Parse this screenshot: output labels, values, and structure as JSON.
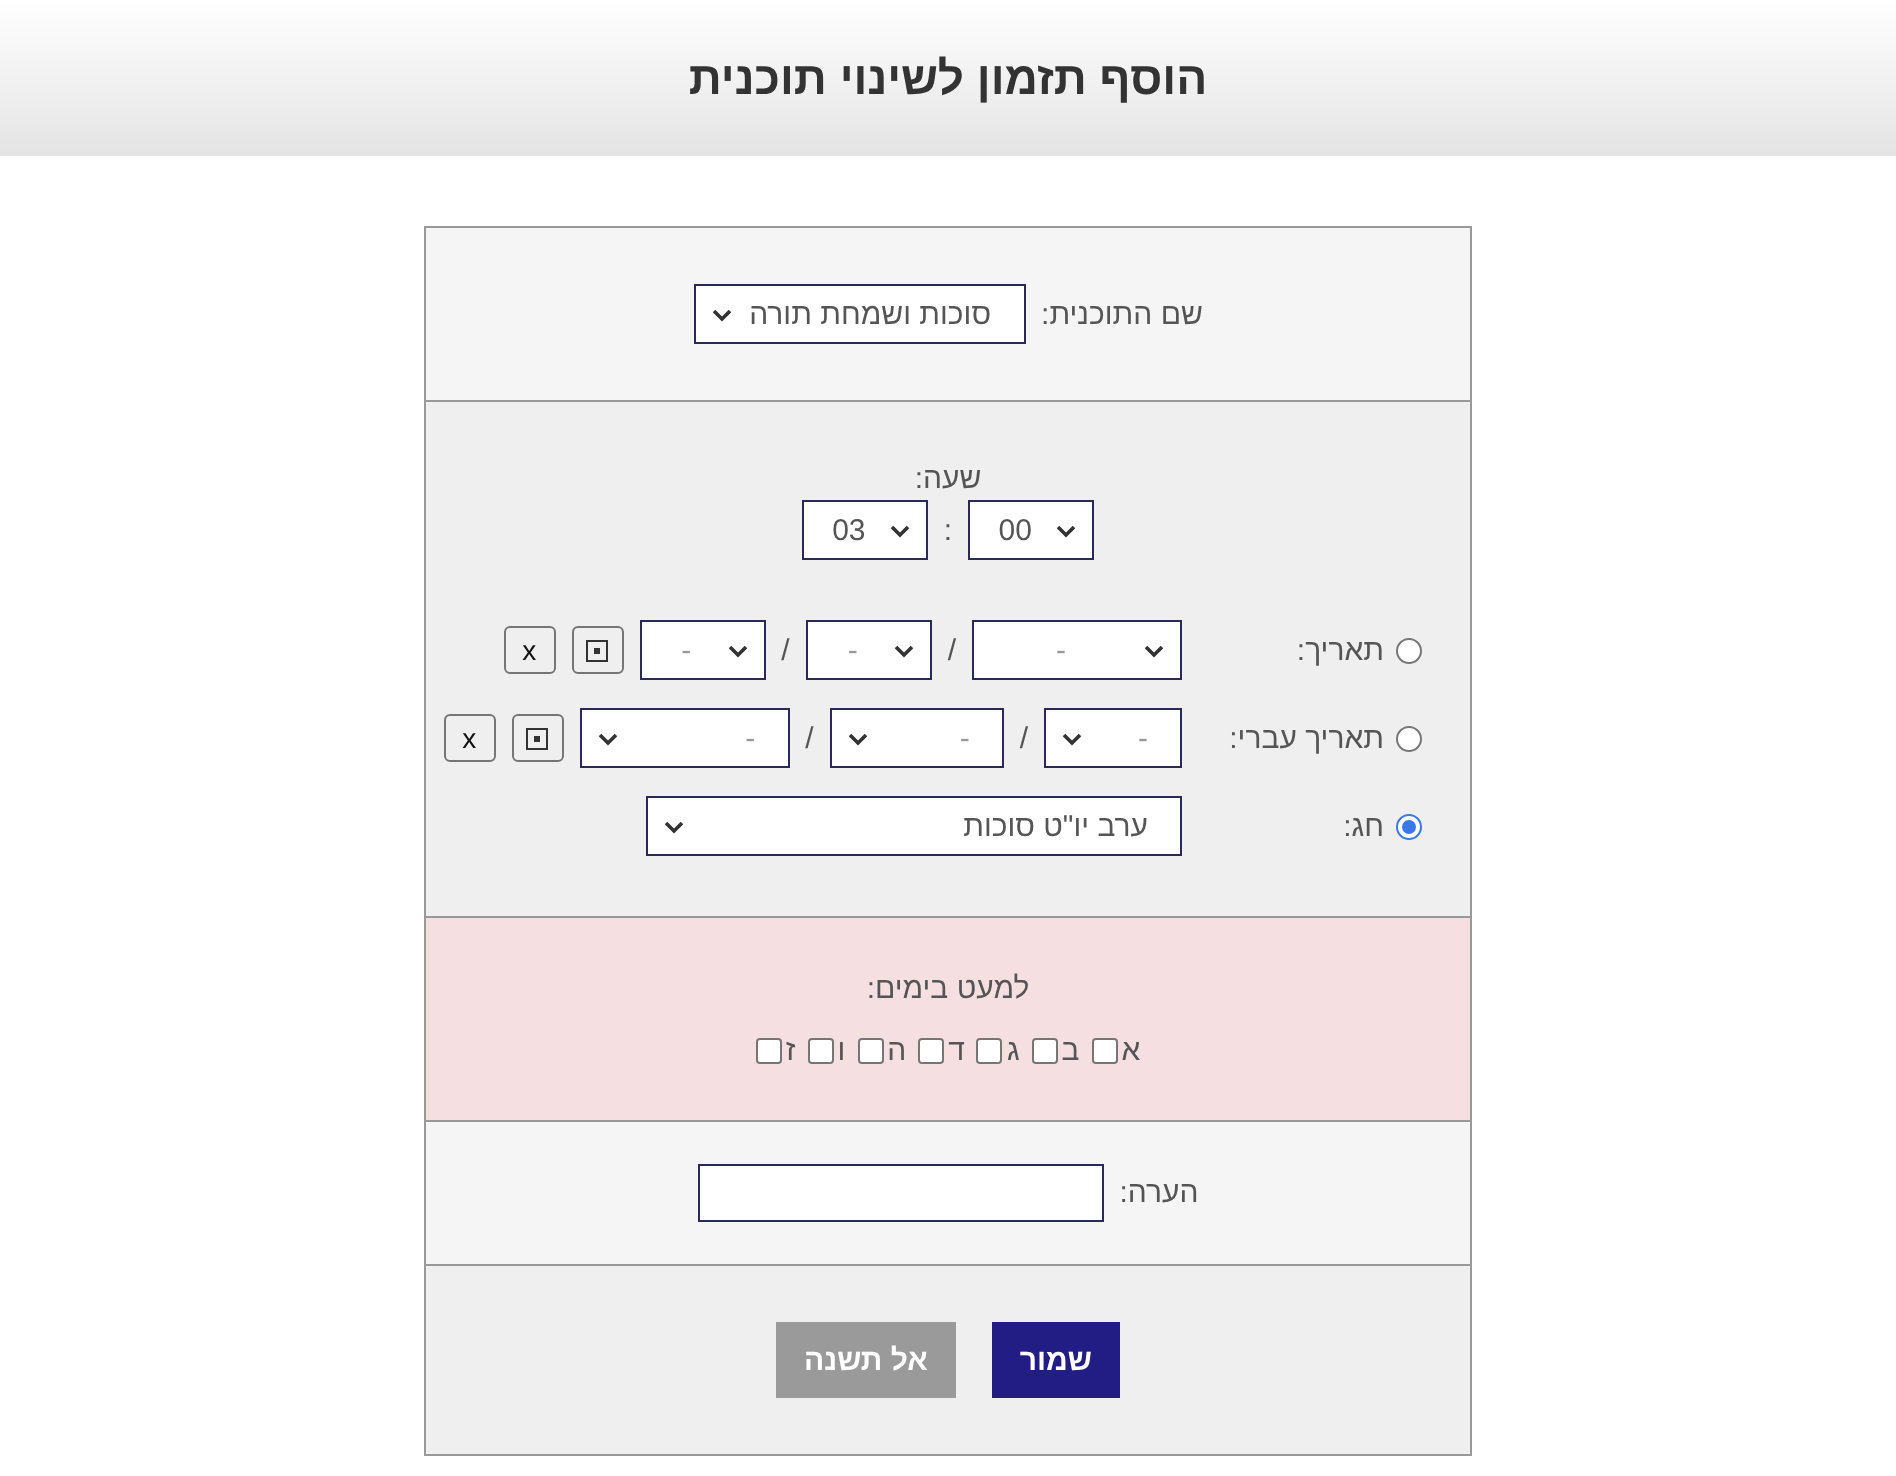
{
  "header": {
    "title": "הוסף תזמון לשינוי תוכנית"
  },
  "program": {
    "label": "שם התוכנית:",
    "value": "סוכות ושמחת תורה"
  },
  "time": {
    "label": "שעה:",
    "hour": "03",
    "separator": ":",
    "minute": "00"
  },
  "date_options": [
    {
      "kind": "gregorian",
      "label": "תאריך:",
      "selected": false,
      "fields": [
        "-",
        "-",
        "-"
      ],
      "separators": [
        "/",
        "/"
      ],
      "clear": "x"
    },
    {
      "kind": "hebrew",
      "label": "תאריך עברי:",
      "selected": false,
      "fields": [
        "-",
        "-",
        "-"
      ],
      "separators": [
        "/",
        "/"
      ],
      "clear": "x"
    },
    {
      "kind": "holiday",
      "label": "חג:",
      "selected": true,
      "value": "ערב יו\"ט סוכות"
    }
  ],
  "days": {
    "label": "למעט בימים:",
    "items": [
      {
        "label": "א",
        "checked": false
      },
      {
        "label": "ב",
        "checked": false
      },
      {
        "label": "ג",
        "checked": false
      },
      {
        "label": "ד",
        "checked": false
      },
      {
        "label": "ה",
        "checked": false
      },
      {
        "label": "ו",
        "checked": false
      },
      {
        "label": "ז",
        "checked": false
      }
    ]
  },
  "note": {
    "label": "הערה:"
  },
  "buttons": [
    {
      "label": "שמור",
      "kind": "primary"
    },
    {
      "label": "אל תשנה",
      "kind": "secondary"
    }
  ]
}
